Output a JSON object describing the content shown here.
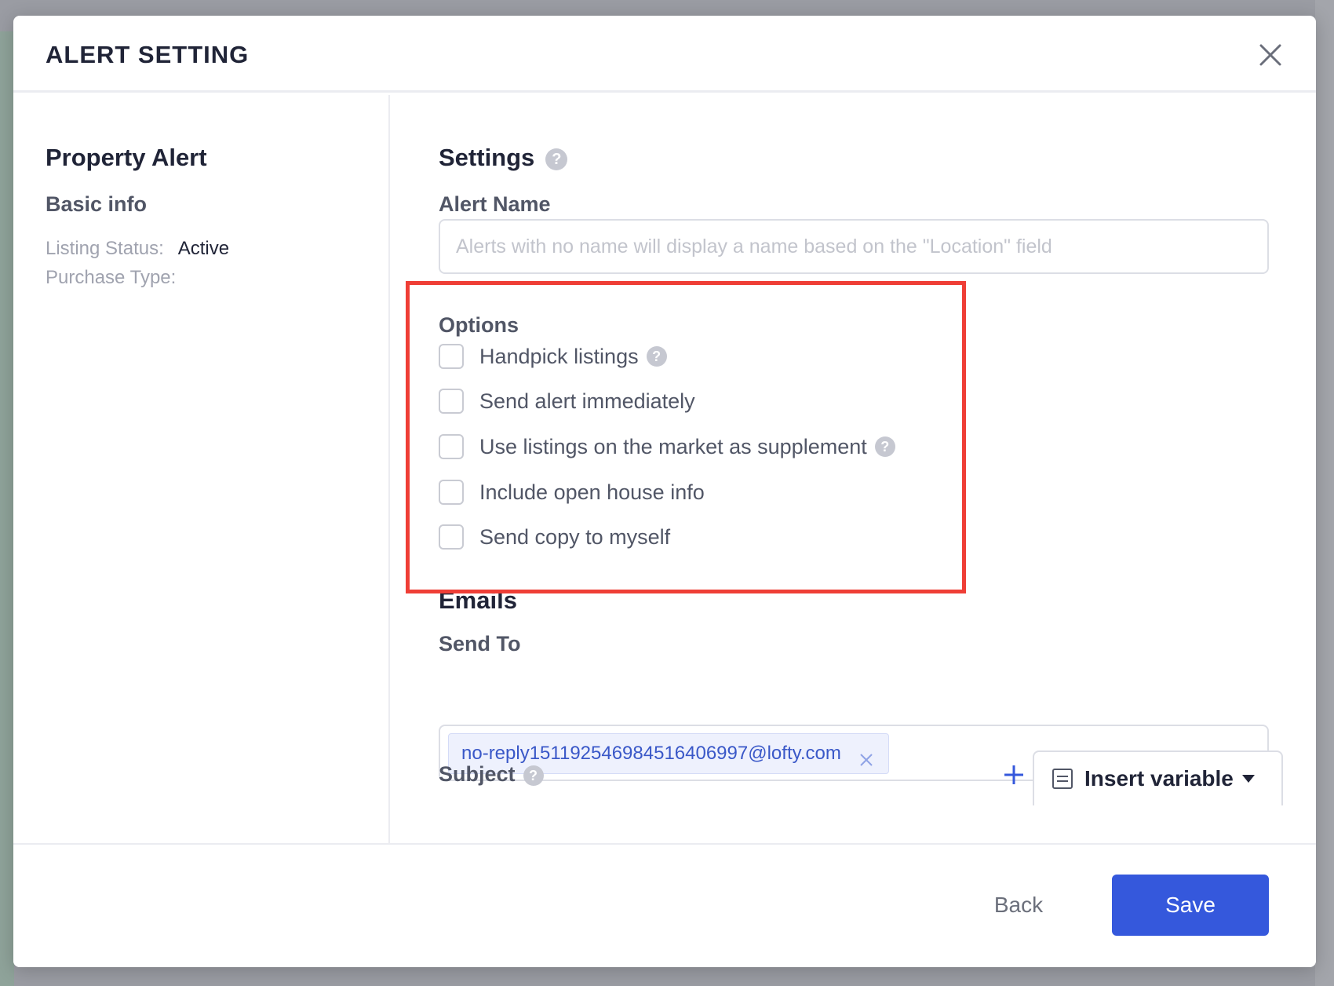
{
  "modal": {
    "title": "ALERT SETTING",
    "close_icon": "close-icon"
  },
  "left": {
    "title": "Property Alert",
    "subtitle": "Basic info",
    "listing_status_label": "Listing Status:",
    "listing_status_value": "Active",
    "purchase_type_label": "Purchase Type:",
    "purchase_type_value": ""
  },
  "settings": {
    "title": "Settings",
    "alert_name_label": "Alert Name",
    "alert_name_placeholder": "Alerts with no name will display a name based on the \"Location\" field",
    "alert_name_value": ""
  },
  "options": {
    "title": "Options",
    "highlight_color": "#ef3e36",
    "items": [
      {
        "label": "Handpick listings",
        "checked": false,
        "help": true
      },
      {
        "label": "Send alert immediately",
        "checked": false,
        "help": false
      },
      {
        "label": "Use listings on the market as supplement",
        "checked": false,
        "help": true
      },
      {
        "label": "Include open house info",
        "checked": false,
        "help": false
      },
      {
        "label": "Send copy to myself",
        "checked": false,
        "help": false
      }
    ]
  },
  "emails": {
    "title": "Emails",
    "send_to_label": "Send To",
    "send_to_tags": [
      "no-reply15119254698451640699 7@lofty.com"
    ],
    "subject_label": "Subject",
    "insert_variable_label": "Insert variable"
  },
  "footer": {
    "back_label": "Back",
    "save_label": "Save",
    "save_color": "#3558dc"
  }
}
